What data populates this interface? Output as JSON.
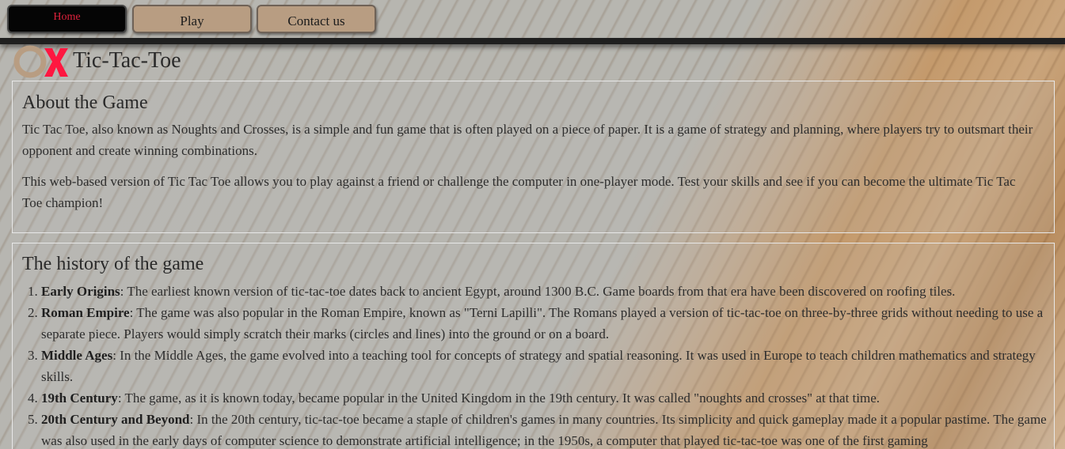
{
  "nav": {
    "home_label": "Home",
    "play_label": "Play",
    "contact_label": "Contact us",
    "active_color": "#e0223c"
  },
  "brand": {
    "logo_icon": "tic-tac-toe-ox-logo",
    "title": "Tic-Tac-Toe"
  },
  "about": {
    "heading": "About the Game",
    "paragraphs": [
      "Tic Tac Toe, also known as Noughts and Crosses, is a simple and fun game that is often played on a piece of paper. It is a game of strategy and planning, where players try to outsmart their opponent and create winning combinations.",
      "This web-based version of Tic Tac Toe allows you to play against a friend or challenge the computer in one-player mode. Test your skills and see if you can become the ultimate Tic Tac Toe champion!"
    ]
  },
  "history": {
    "heading": "The history of the game",
    "items": [
      {
        "title": "Early Origins",
        "text": ": The earliest known version of tic-tac-toe dates back to ancient Egypt, around 1300 B.C. Game boards from that era have been discovered on roofing tiles."
      },
      {
        "title": "Roman Empire",
        "text": ": The game was also popular in the Roman Empire, known as \"Terni Lapilli\". The Romans played a version of tic-tac-toe on three-by-three grids without needing to use a separate piece. Players would simply scratch their marks (circles and lines) into the ground or on a board."
      },
      {
        "title": "Middle Ages",
        "text": ": In the Middle Ages, the game evolved into a teaching tool for concepts of strategy and spatial reasoning. It was used in Europe to teach children mathematics and strategy skills."
      },
      {
        "title": "19th Century",
        "text": ": The game, as it is known today, became popular in the United Kingdom in the 19th century. It was called \"noughts and crosses\" at that time."
      },
      {
        "title": "20th Century and Beyond",
        "text": ": In the 20th century, tic-tac-toe became a staple of children's games in many countries. Its simplicity and quick gameplay made it a popular pastime. The game was also used in the early days of computer science to demonstrate artificial intelligence; in the 1950s, a computer that played tic-tac-toe was one of the first gaming"
      }
    ]
  }
}
